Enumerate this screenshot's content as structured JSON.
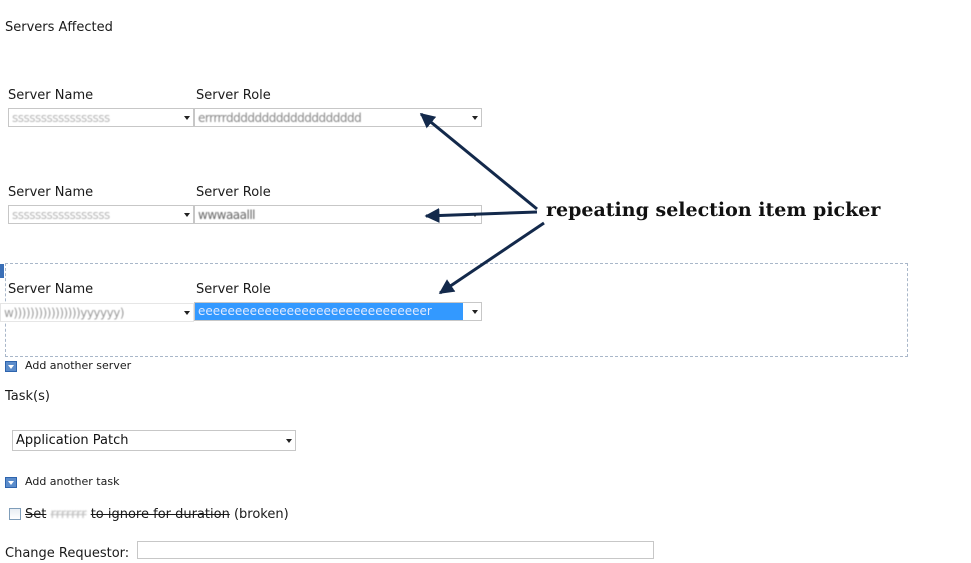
{
  "section_title": "Servers Affected",
  "server_rows": [
    {
      "name_label": "Server Name",
      "role_label": "Server Role",
      "name_value": "sssssssssssssssss",
      "role_value": "errrrrddddddddddddddddddd",
      "selected": false
    },
    {
      "name_label": "Server Name",
      "role_label": "Server Role",
      "name_value": "sssssssssssssssss",
      "role_value": "wwwaaalll",
      "selected": false
    },
    {
      "name_label": "Server Name",
      "role_label": "Server Role",
      "name_value": "w))))))))))))))))yyyyyy)",
      "role_value": "eeeeeeeeeeeeeeeeeeeeeeeeeeeeeeer",
      "selected": true
    }
  ],
  "add_server_label": "Add another server",
  "annotation_text": "repeating selection item picker",
  "tasks_label": "Task(s)",
  "task_select_value": "Application Patch",
  "add_task_label": "Add another task",
  "ignore_checkbox_label_prefix": "Set",
  "ignore_checkbox_label_hidden": "rrrrrrr",
  "ignore_checkbox_label_struck": "to ignore for duration",
  "ignore_checkbox_label_suffix": "(broken)",
  "change_requestor_label": "Change Requestor:",
  "change_requestor_value": "",
  "colors": {
    "selected_highlight": "#3399ff",
    "arrow": "#13294b",
    "add_button": "#5b8ccb"
  }
}
